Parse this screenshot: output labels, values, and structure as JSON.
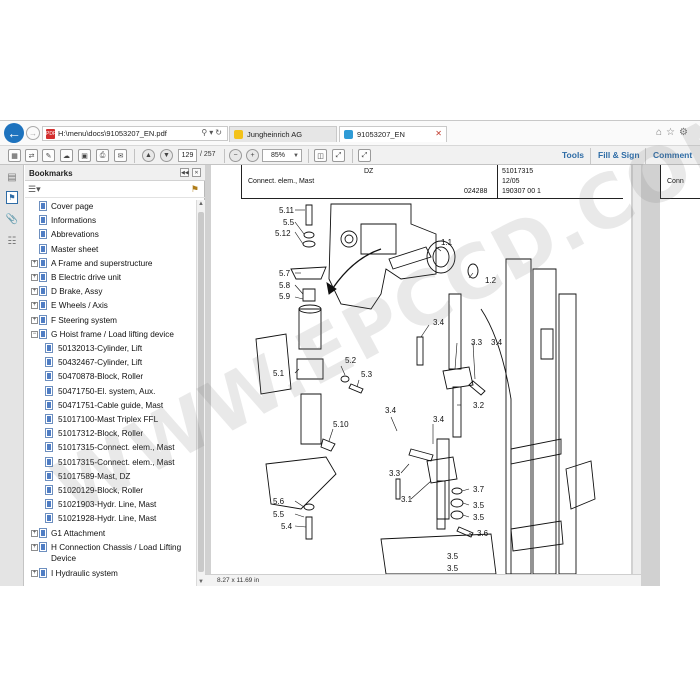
{
  "browser": {
    "url": "H:\\menu\\docs\\91053207_EN.pdf",
    "tabs": [
      {
        "label": "Jungheinrich AG"
      },
      {
        "label": "91053207_EN"
      }
    ]
  },
  "toolbar": {
    "page_current": "129",
    "page_total": "/ 257",
    "zoom": "85%",
    "tools_label": "Tools",
    "fill_sign_label": "Fill & Sign",
    "comment_label": "Comment"
  },
  "bookmarks": {
    "title": "Bookmarks",
    "items": [
      {
        "label": "Cover page",
        "expander": ""
      },
      {
        "label": "Informations",
        "expander": ""
      },
      {
        "label": "Abbrevations",
        "expander": ""
      },
      {
        "label": "Master sheet",
        "expander": ""
      },
      {
        "label": "A Frame and superstructure",
        "expander": "+"
      },
      {
        "label": "B Electric drive unit",
        "expander": "+"
      },
      {
        "label": "D Brake, Assy",
        "expander": "+"
      },
      {
        "label": "E Wheels / Axis",
        "expander": "+"
      },
      {
        "label": "F Steering system",
        "expander": "+"
      },
      {
        "label": "G Hoist frame / Load lifting device",
        "expander": "−"
      },
      {
        "label": "50132013-Cylinder, Lift",
        "expander": ""
      },
      {
        "label": "50432467-Cylinder, Lift",
        "expander": ""
      },
      {
        "label": "50470878-Block, Roller",
        "expander": ""
      },
      {
        "label": "50471750-El. system,  Aux.",
        "expander": ""
      },
      {
        "label": "50471751-Cable guide,  Mast",
        "expander": ""
      },
      {
        "label": "51017100-Mast Triplex FFL",
        "expander": ""
      },
      {
        "label": "51017312-Block, Roller",
        "expander": ""
      },
      {
        "label": "51017315-Connect. elem.,  Mast",
        "expander": ""
      },
      {
        "label": "51017315-Connect. elem.,  Mast",
        "expander": ""
      },
      {
        "label": "51017589-Mast, DZ",
        "expander": ""
      },
      {
        "label": "51020129-Block, Roller",
        "expander": ""
      },
      {
        "label": "51021903-Hydr. Line,  Mast",
        "expander": ""
      },
      {
        "label": "51021928-Hydr. Line,  Mast",
        "expander": ""
      },
      {
        "label": "G1 Attachment",
        "expander": "+"
      },
      {
        "label": "H Connection Chassis / Load Lifting",
        "label2": "Device",
        "expander": "+"
      },
      {
        "label": "I Hydraulic system",
        "expander": "+"
      }
    ]
  },
  "document": {
    "block_code": "DZ",
    "block_title": "Connect. elem.,  Mast",
    "block_number": "024288",
    "part_number": "51017315",
    "date": "12/05",
    "doc_code": "190307 00 1",
    "next_page_title": "Conn",
    "page_size": "8.27 x 11.69 in",
    "callouts": [
      "5.11",
      "5.5",
      "5.12",
      "1.1",
      "1.2",
      "5.7",
      "5.8",
      "5.9",
      "3.4",
      "3.3",
      "3.4",
      "5.1",
      "5.2",
      "5.3",
      "3.2",
      "3.4",
      "3.4",
      "5.10",
      "3.3",
      "3.7",
      "3.1",
      "3.5",
      "3.5",
      "3.6",
      "5.6",
      "5.5",
      "5.4",
      "3.5",
      "3.5"
    ]
  },
  "watermark": "WWW.EPCCD.COM"
}
